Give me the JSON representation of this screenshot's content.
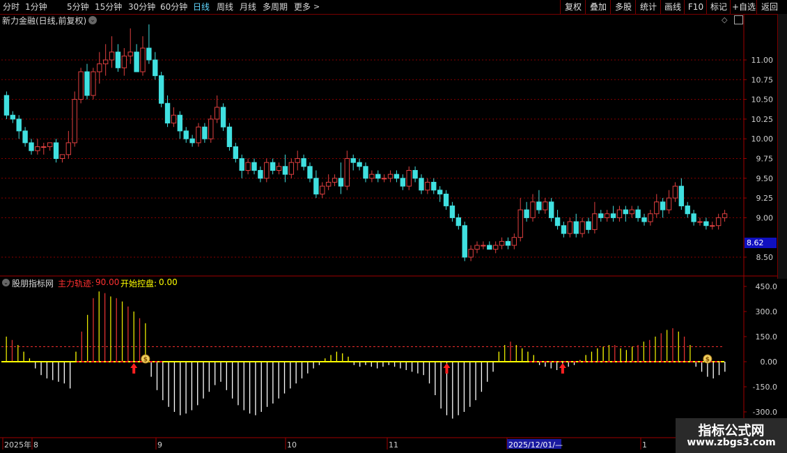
{
  "toolbar": {
    "periods": [
      "分时",
      "1分钟",
      "5分钟",
      "15分钟",
      "30分钟",
      "60分钟",
      "日线",
      "周线",
      "月线",
      "多周期",
      "更多"
    ],
    "active_period": "日线",
    "buttons": [
      "复权",
      "叠加",
      "多股",
      "统计",
      "画线",
      "F10",
      "标记",
      "+自选",
      "返回"
    ]
  },
  "main_chart": {
    "title": "新力金融(日线,前复权)",
    "current_price": "8.62",
    "price_ticks": [
      "11.00",
      "10.75",
      "10.50",
      "10.25",
      "10.00",
      "9.75",
      "9.50",
      "9.25",
      "9.00",
      "8.50"
    ]
  },
  "indicator": {
    "name": "股朋指标网",
    "label1": "主力轨迹:",
    "value1": "90.00",
    "label2": "开始控盘:",
    "value2": "0.00",
    "ticks": [
      "450.0",
      "300.0",
      "150.0",
      "0.00",
      "-150.0",
      "-300.0"
    ]
  },
  "time_axis": [
    "2025年",
    "8",
    "9",
    "10",
    "11",
    "2025/12/01/—",
    "1"
  ],
  "watermark": {
    "title": "指标公式网",
    "url": "www.zbgs3.com"
  },
  "colors": {
    "up": "#e04040",
    "down": "#40e0e0",
    "grid": "#8a0000",
    "yellow": "#ffff00",
    "white": "#ffffff"
  },
  "chart_data": {
    "type": "candlestick",
    "ylim": [
      8.3,
      11.5
    ],
    "ohlc": [
      [
        10.55,
        10.6,
        10.25,
        10.3
      ],
      [
        10.3,
        10.35,
        10.2,
        10.25
      ],
      [
        10.25,
        10.3,
        10.0,
        10.1
      ],
      [
        10.1,
        10.15,
        9.9,
        9.95
      ],
      [
        9.95,
        10.0,
        9.8,
        9.85
      ],
      [
        9.85,
        10.0,
        9.8,
        9.9
      ],
      [
        9.9,
        9.95,
        9.8,
        9.9
      ],
      [
        9.9,
        9.95,
        9.85,
        9.95
      ],
      [
        9.95,
        10.0,
        9.7,
        9.75
      ],
      [
        9.75,
        9.8,
        9.7,
        9.8
      ],
      [
        9.8,
        10.1,
        9.75,
        9.95
      ],
      [
        9.95,
        10.6,
        9.9,
        10.5
      ],
      [
        10.5,
        10.9,
        10.45,
        10.85
      ],
      [
        10.85,
        10.95,
        10.5,
        10.55
      ],
      [
        10.55,
        10.9,
        10.5,
        10.85
      ],
      [
        10.85,
        11.1,
        10.7,
        10.95
      ],
      [
        10.95,
        11.2,
        10.8,
        11.0
      ],
      [
        11.0,
        11.3,
        10.9,
        11.1
      ],
      [
        11.1,
        11.2,
        10.85,
        10.9
      ],
      [
        10.9,
        11.15,
        10.8,
        11.05
      ],
      [
        11.05,
        11.4,
        10.95,
        11.1
      ],
      [
        11.1,
        11.2,
        10.85,
        10.85
      ],
      [
        10.85,
        11.3,
        10.8,
        11.15
      ],
      [
        11.15,
        11.45,
        10.95,
        11.0
      ],
      [
        11.0,
        11.1,
        10.75,
        10.8
      ],
      [
        10.8,
        10.85,
        10.4,
        10.45
      ],
      [
        10.45,
        10.55,
        10.15,
        10.2
      ],
      [
        10.2,
        10.4,
        10.15,
        10.3
      ],
      [
        10.3,
        10.35,
        10.0,
        10.1
      ],
      [
        10.1,
        10.15,
        9.95,
        10.0
      ],
      [
        10.0,
        10.05,
        9.9,
        9.95
      ],
      [
        9.95,
        10.2,
        9.9,
        10.15
      ],
      [
        10.15,
        10.2,
        9.95,
        10.0
      ],
      [
        10.0,
        10.3,
        9.95,
        10.25
      ],
      [
        10.25,
        10.55,
        10.2,
        10.4
      ],
      [
        10.4,
        10.45,
        10.1,
        10.15
      ],
      [
        10.15,
        10.2,
        9.85,
        9.9
      ],
      [
        9.9,
        9.95,
        9.7,
        9.75
      ],
      [
        9.75,
        9.8,
        9.5,
        9.6
      ],
      [
        9.6,
        9.75,
        9.55,
        9.7
      ],
      [
        9.7,
        9.75,
        9.55,
        9.6
      ],
      [
        9.6,
        9.65,
        9.45,
        9.5
      ],
      [
        9.5,
        9.75,
        9.45,
        9.7
      ],
      [
        9.7,
        9.75,
        9.55,
        9.6
      ],
      [
        9.6,
        9.7,
        9.55,
        9.65
      ],
      [
        9.65,
        9.8,
        9.45,
        9.55
      ],
      [
        9.55,
        9.75,
        9.5,
        9.7
      ],
      [
        9.7,
        9.85,
        9.6,
        9.75
      ],
      [
        9.75,
        9.8,
        9.6,
        9.65
      ],
      [
        9.65,
        9.7,
        9.45,
        9.5
      ],
      [
        9.5,
        9.6,
        9.25,
        9.3
      ],
      [
        9.3,
        9.45,
        9.25,
        9.4
      ],
      [
        9.4,
        9.55,
        9.35,
        9.45
      ],
      [
        9.45,
        9.55,
        9.4,
        9.5
      ],
      [
        9.5,
        9.7,
        9.3,
        9.4
      ],
      [
        9.4,
        9.85,
        9.35,
        9.75
      ],
      [
        9.75,
        9.8,
        9.6,
        9.7
      ],
      [
        9.7,
        9.75,
        9.6,
        9.65
      ],
      [
        9.65,
        9.7,
        9.45,
        9.5
      ],
      [
        9.5,
        9.6,
        9.45,
        9.55
      ],
      [
        9.55,
        9.6,
        9.45,
        9.5
      ],
      [
        9.5,
        9.55,
        9.45,
        9.5
      ],
      [
        9.5,
        9.6,
        9.45,
        9.55
      ],
      [
        9.55,
        9.6,
        9.45,
        9.5
      ],
      [
        9.5,
        9.55,
        9.35,
        9.4
      ],
      [
        9.4,
        9.65,
        9.35,
        9.6
      ],
      [
        9.6,
        9.65,
        9.45,
        9.5
      ],
      [
        9.5,
        9.55,
        9.3,
        9.35
      ],
      [
        9.35,
        9.5,
        9.3,
        9.45
      ],
      [
        9.45,
        9.5,
        9.3,
        9.35
      ],
      [
        9.35,
        9.4,
        9.2,
        9.3
      ],
      [
        9.3,
        9.35,
        9.1,
        9.15
      ],
      [
        9.15,
        9.2,
        8.95,
        9.0
      ],
      [
        9.0,
        9.05,
        8.85,
        8.9
      ],
      [
        8.9,
        8.95,
        8.45,
        8.5
      ],
      [
        8.5,
        8.65,
        8.45,
        8.6
      ],
      [
        8.6,
        8.7,
        8.55,
        8.65
      ],
      [
        8.65,
        8.7,
        8.6,
        8.65
      ],
      [
        8.65,
        8.7,
        8.6,
        8.6
      ],
      [
        8.6,
        8.7,
        8.55,
        8.65
      ],
      [
        8.65,
        8.75,
        8.6,
        8.7
      ],
      [
        8.7,
        8.75,
        8.6,
        8.65
      ],
      [
        8.65,
        8.8,
        8.6,
        8.75
      ],
      [
        8.75,
        9.25,
        8.7,
        9.1
      ],
      [
        9.1,
        9.2,
        8.95,
        9.0
      ],
      [
        9.0,
        9.3,
        8.95,
        9.2
      ],
      [
        9.2,
        9.35,
        9.05,
        9.1
      ],
      [
        9.1,
        9.25,
        9.05,
        9.2
      ],
      [
        9.2,
        9.25,
        8.95,
        9.0
      ],
      [
        9.0,
        9.1,
        8.85,
        8.9
      ],
      [
        8.9,
        8.95,
        8.75,
        8.8
      ],
      [
        8.8,
        9.0,
        8.75,
        8.95
      ],
      [
        8.95,
        9.05,
        8.75,
        8.8
      ],
      [
        8.8,
        9.0,
        8.75,
        8.95
      ],
      [
        8.95,
        9.0,
        8.8,
        8.85
      ],
      [
        8.85,
        9.2,
        8.8,
        9.05
      ],
      [
        9.05,
        9.1,
        8.95,
        9.0
      ],
      [
        9.0,
        9.1,
        8.95,
        9.05
      ],
      [
        9.05,
        9.15,
        8.95,
        9.0
      ],
      [
        9.0,
        9.15,
        8.95,
        9.1
      ],
      [
        9.1,
        9.15,
        8.95,
        9.05
      ],
      [
        9.05,
        9.15,
        9.0,
        9.1
      ],
      [
        9.1,
        9.15,
        8.95,
        9.0
      ],
      [
        9.0,
        9.05,
        8.9,
        8.95
      ],
      [
        8.95,
        9.1,
        8.9,
        9.05
      ],
      [
        9.05,
        9.3,
        9.0,
        9.2
      ],
      [
        9.2,
        9.25,
        9.0,
        9.1
      ],
      [
        9.1,
        9.35,
        9.05,
        9.25
      ],
      [
        9.25,
        9.45,
        9.2,
        9.4
      ],
      [
        9.4,
        9.5,
        9.1,
        9.15
      ],
      [
        9.15,
        9.2,
        9.0,
        9.05
      ],
      [
        9.05,
        9.1,
        8.9,
        8.95
      ],
      [
        8.95,
        9.0,
        8.9,
        8.95
      ],
      [
        8.95,
        9.0,
        8.85,
        8.9
      ],
      [
        8.9,
        8.95,
        8.85,
        8.9
      ],
      [
        8.9,
        9.05,
        8.85,
        9.0
      ],
      [
        9.0,
        9.1,
        8.95,
        9.05
      ]
    ],
    "indicator_values": [
      150,
      130,
      100,
      60,
      20,
      -40,
      -80,
      -100,
      -110,
      -120,
      -130,
      -160,
      60,
      180,
      280,
      380,
      420,
      410,
      390,
      380,
      360,
      330,
      300,
      260,
      230,
      -90,
      -170,
      -230,
      -270,
      -300,
      -320,
      -310,
      -290,
      -260,
      -220,
      -180,
      -140,
      -120,
      -170,
      -220,
      -260,
      -290,
      -310,
      -320,
      -300,
      -270,
      -250,
      -220,
      -190,
      -160,
      -130,
      -100,
      -70,
      -40,
      -20,
      20,
      40,
      60,
      50,
      30,
      -20,
      -30,
      -20,
      -30,
      -40,
      -30,
      -20,
      -30,
      -40,
      -50,
      -60,
      -70,
      -80,
      -130,
      -200,
      -280,
      -320,
      -340,
      -320,
      -300,
      -270,
      -230,
      -180,
      -120,
      -60,
      60,
      100,
      120,
      100,
      80,
      60,
      40,
      -20,
      -30,
      -40,
      -50,
      -40,
      -30,
      -20,
      10,
      40,
      60,
      80,
      90,
      100,
      100,
      80,
      70,
      90,
      100,
      120,
      130,
      150,
      170,
      190,
      200,
      180,
      150,
      100,
      -30,
      -60,
      -90,
      -100,
      -80,
      -60
    ],
    "arrows": [
      22,
      76,
      96,
      166
    ],
    "bags": [
      24,
      121,
      179,
      201
    ]
  }
}
